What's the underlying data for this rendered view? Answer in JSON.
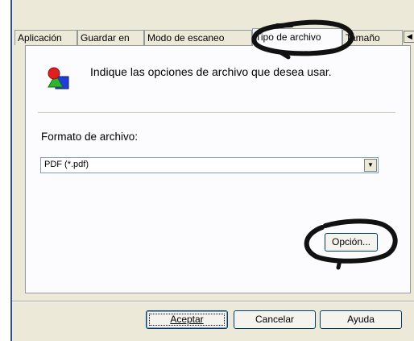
{
  "tabs": [
    {
      "label": "Aplicación",
      "active": false
    },
    {
      "label": "Guardar en",
      "active": false
    },
    {
      "label": "Modo de escaneo",
      "active": false
    },
    {
      "label": "Tipo de archivo",
      "active": true
    },
    {
      "label": "Tamaño",
      "active": false
    }
  ],
  "header": {
    "text": "Indique las opciones de archivo que desea usar.",
    "icon": "file-type-shapes-icon"
  },
  "form": {
    "format_label": "Formato de archivo:",
    "format_value": "PDF (*.pdf)",
    "option_button": "Opción..."
  },
  "footer": {
    "accept": "Aceptar",
    "cancel": "Cancelar",
    "help": "Ayuda"
  },
  "colors": {
    "dialog_bg": "#ece9d8",
    "page_bg": "#fcfcfe",
    "accent_border": "#2b4fae"
  }
}
